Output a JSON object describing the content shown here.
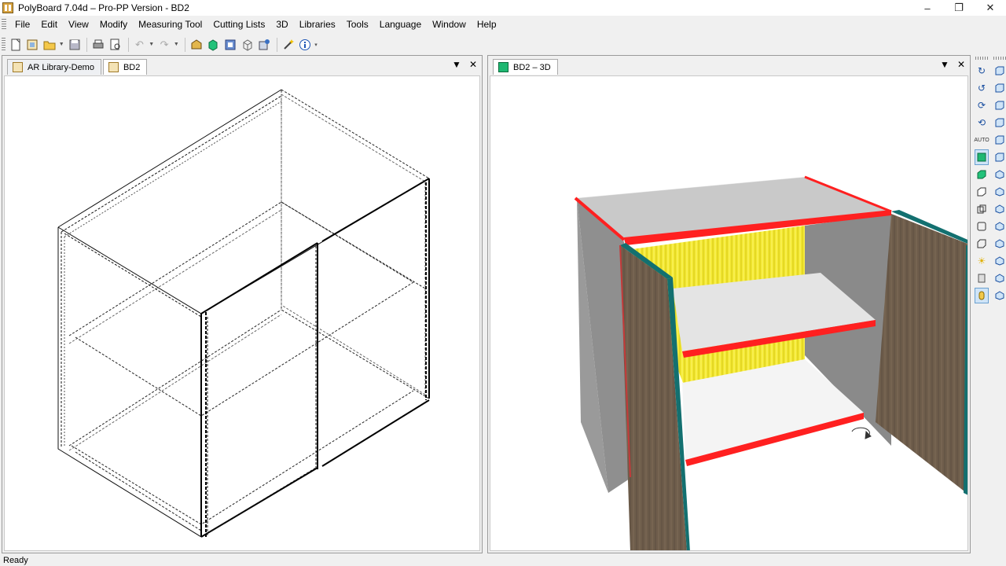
{
  "window": {
    "title": "PolyBoard 7.04d – Pro-PP Version - BD2"
  },
  "menu": [
    "File",
    "Edit",
    "View",
    "Modify",
    "Measuring Tool",
    "Cutting Lists",
    "3D",
    "Libraries",
    "Tools",
    "Language",
    "Window",
    "Help"
  ],
  "left_panel": {
    "tabs": [
      {
        "label": "AR Library-Demo"
      },
      {
        "label": "BD2"
      }
    ]
  },
  "right_panel": {
    "tabs": [
      {
        "label": "BD2 – 3D"
      }
    ]
  },
  "status": {
    "text": "Ready"
  },
  "colors": {
    "edge_red": "#ff2020",
    "back_yellow": "#f2e830",
    "door_brown": "#6e5d4b",
    "door_edge_teal": "#137070",
    "side_grey": "#8f8f8f"
  },
  "icons": {
    "toolbar": [
      "new-icon",
      "open-library-icon",
      "open-folder-icon",
      "save-icon",
      "print-icon",
      "print-preview-icon",
      "undo-icon",
      "redo-icon",
      "cabinet-icon",
      "3d-view-icon",
      "render-icon",
      "wireframe-icon",
      "cabinet-settings-icon",
      "magic-wand-icon",
      "info-icon"
    ],
    "vertical_1": [
      "rotate-x-icon",
      "rotate-y-icon",
      "rotate-z-icon",
      "rotate-free-icon",
      "auto-rotate-icon",
      "solid-view-icon",
      "shaded-view-icon",
      "hidden-line-icon",
      "wireframe-view-icon",
      "outline-view-icon",
      "box-outline-icon",
      "light-icon",
      "texture-icon",
      "material-icon"
    ],
    "vertical_2": [
      "view-front-icon",
      "view-back-icon",
      "view-left-icon",
      "view-right-icon",
      "view-top-icon",
      "view-bottom-icon",
      "iso-view-1-icon",
      "iso-view-2-icon",
      "iso-view-3-icon",
      "iso-view-4-icon",
      "iso-view-5-icon",
      "iso-view-6-icon",
      "iso-view-7-icon",
      "iso-view-8-icon"
    ]
  }
}
